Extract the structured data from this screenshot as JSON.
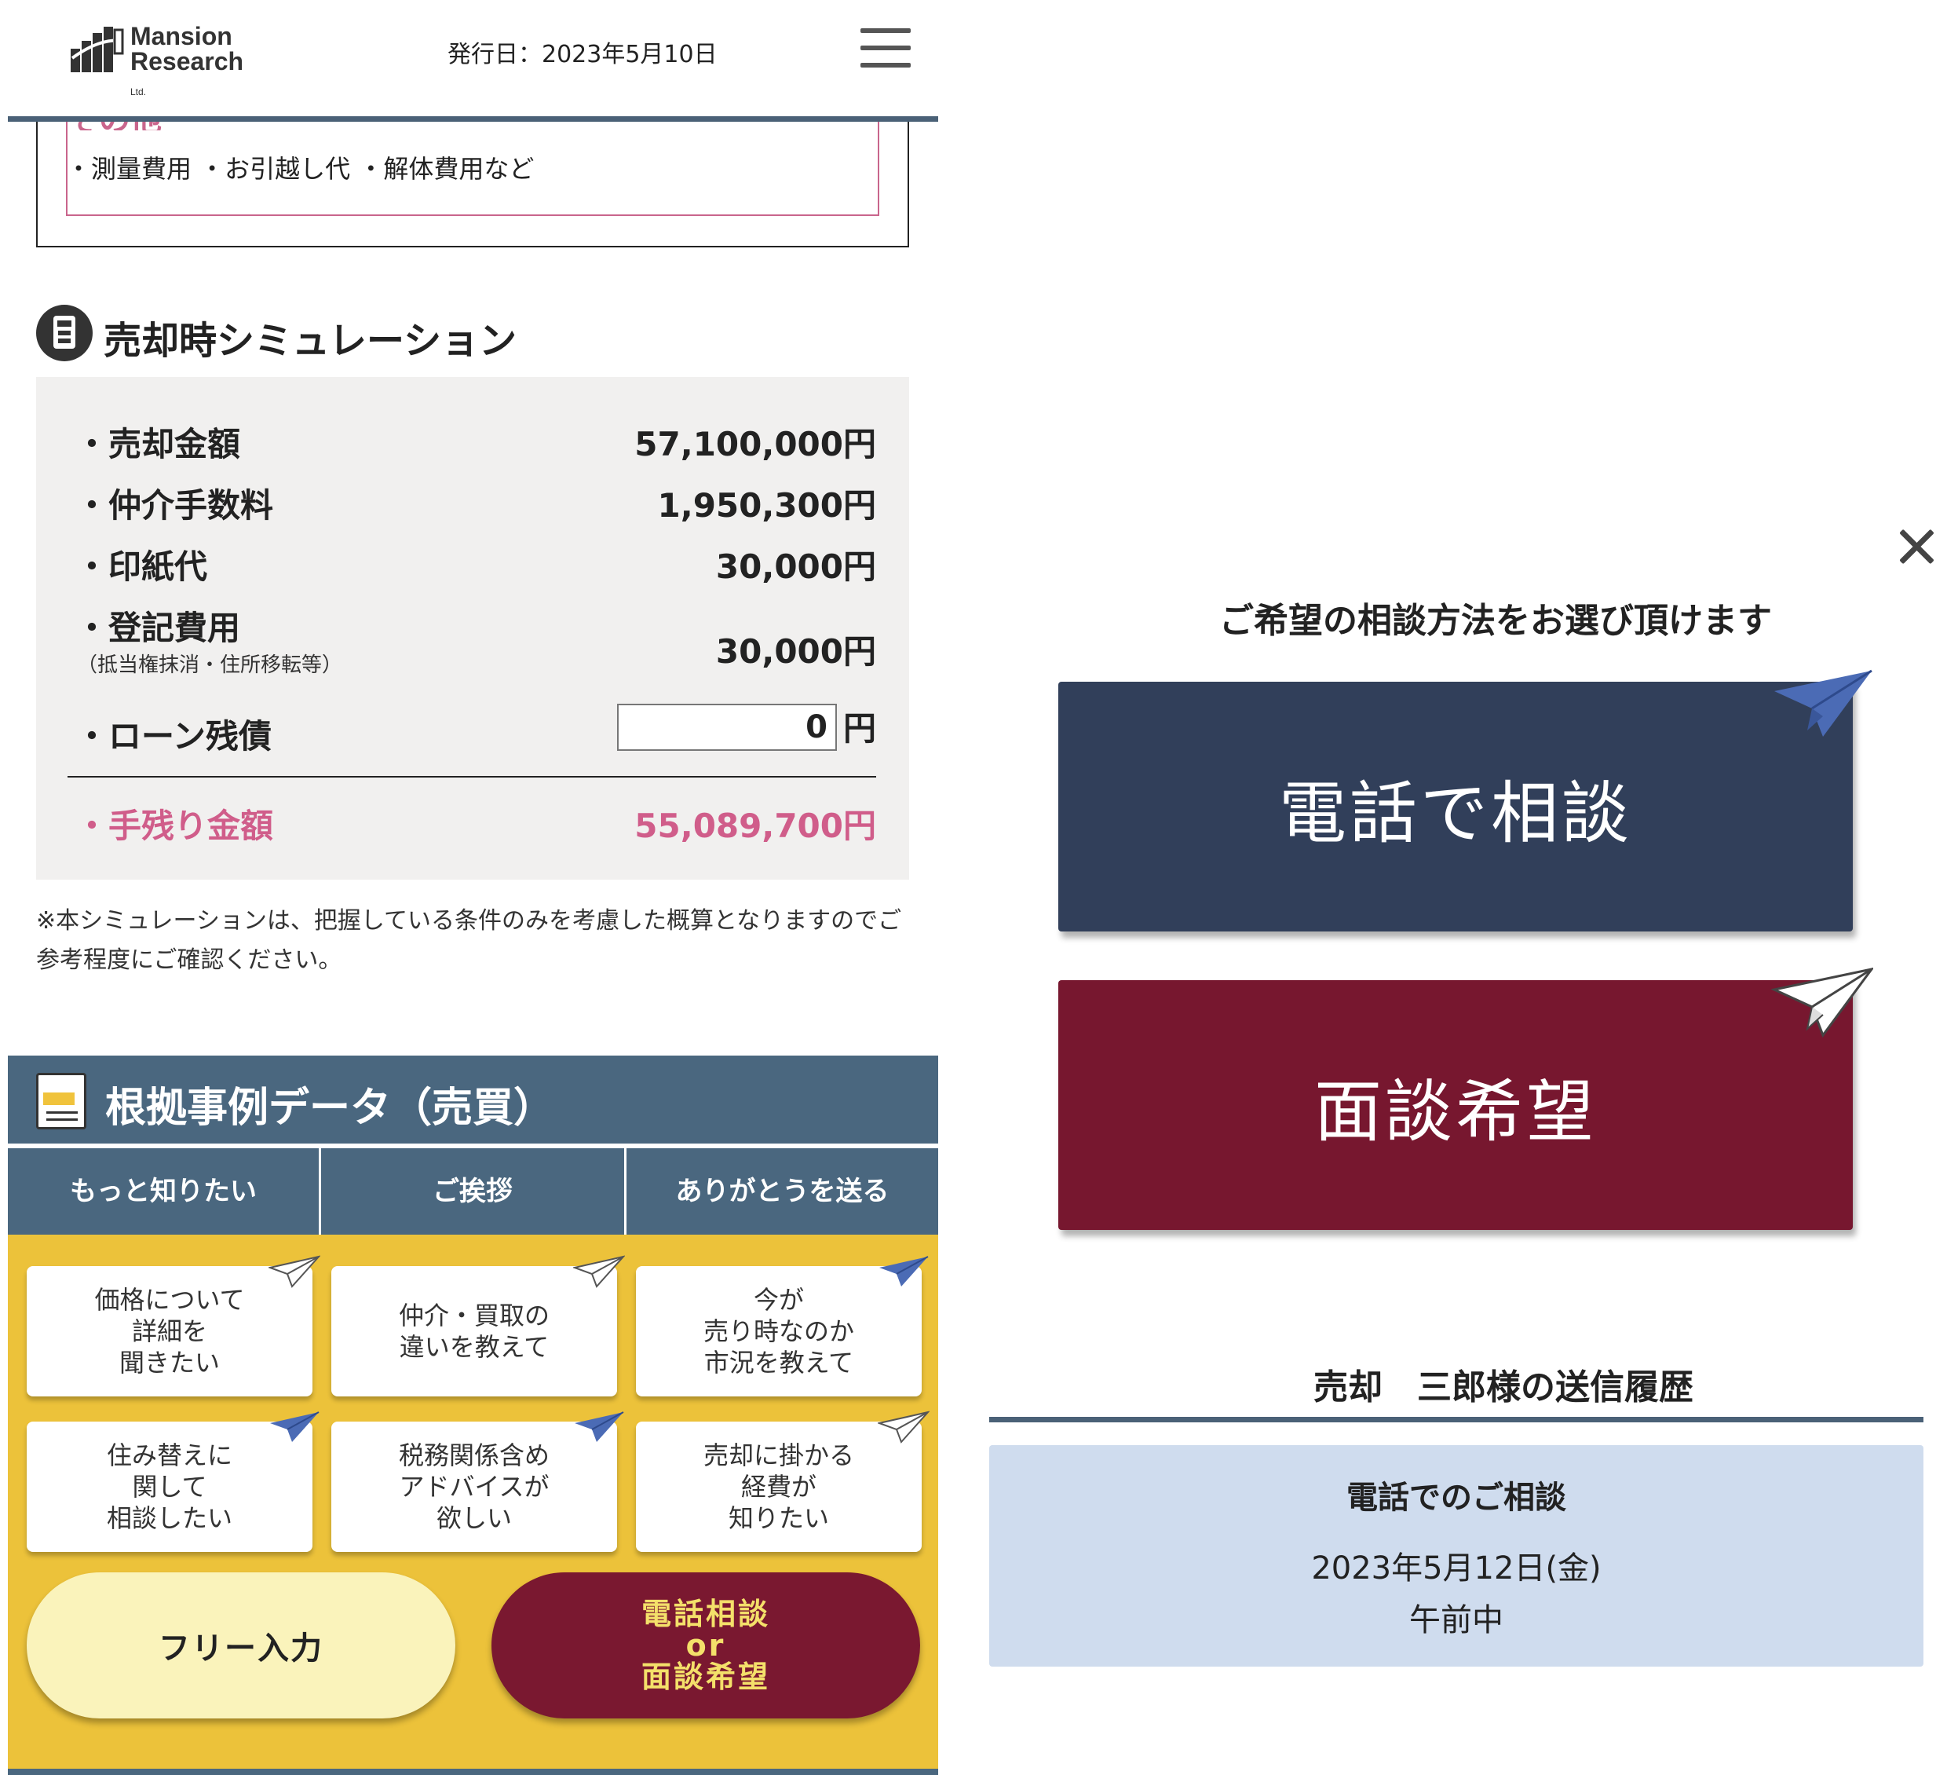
{
  "header": {
    "logo_line1": "Mansion",
    "logo_line2": "Research",
    "logo_suffix": "Ltd.",
    "issue_date": "発行日：2023年5月10日"
  },
  "costs": {
    "section_label": "その他",
    "items": "・測量費用 ・お引越し代 ・解体費用など"
  },
  "simulation": {
    "title": "売却時シミュレーション",
    "rows": [
      {
        "label": "・売却金額",
        "value": "57,100,000円"
      },
      {
        "label": "・仲介手数料",
        "value": "1,950,300円"
      },
      {
        "label": "・印紙代",
        "value": "30,000円"
      },
      {
        "label": "・登記費用",
        "value": "30,000円",
        "note": "（抵当権抹消・住所移転等）"
      }
    ],
    "loan": {
      "label": "・ローン残債",
      "input_value": "0",
      "unit": "円"
    },
    "net": {
      "label": "・手残り金額",
      "value": "55,089,700円"
    },
    "disclaimer": "※本シミュレーションは、把握している条件のみを考慮した概算となりますのでご参考程度にご確認ください。"
  },
  "data_section": {
    "title": "根拠事例データ（売買）",
    "tabs": [
      "もっと知りたい",
      "ご挨拶",
      "ありがとうを送る"
    ],
    "cards": [
      {
        "text": "価格について\n詳細を\n聞きたい",
        "plane": "outline"
      },
      {
        "text": "仲介・買取の\n違いを教えて",
        "plane": "outline"
      },
      {
        "text": "今が\n売り時なのか\n市況を教えて",
        "plane": "blue"
      },
      {
        "text": "住み替えに\n関して\n相談したい",
        "plane": "blue"
      },
      {
        "text": "税務関係含め\nアドバイスが\n欲しい",
        "plane": "blue"
      },
      {
        "text": "売却に掛かる\n経費が\n知りたい",
        "plane": "outline"
      }
    ],
    "free_input_label": "フリー入力",
    "call_button": {
      "line1": "電話相談",
      "line2": "or",
      "line3": "面談希望"
    }
  },
  "modal": {
    "prompt": "ご希望の相談方法をお選び頂けます",
    "phone_button": "電話で相談",
    "meeting_button": "面談希望",
    "history_title": "売却　三郎様の送信履歴",
    "history": {
      "type": "電話でのご相談",
      "date": "2023年5月12日(金)",
      "time": "午前中"
    }
  },
  "colors": {
    "header_blue": "#4a677f",
    "yellow": "#ecc23a",
    "wine": "#7a1830",
    "navy": "#313f5a",
    "pink": "#d05d8a",
    "history_bg": "#cfdcee"
  }
}
